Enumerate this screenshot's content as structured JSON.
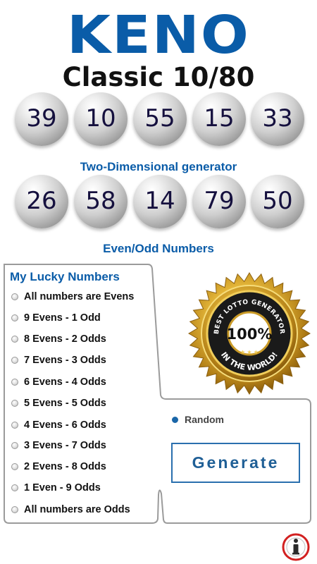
{
  "header": {
    "title": "KENO",
    "subtitle": "Classic 10/80"
  },
  "row1": [
    "39",
    "10",
    "55",
    "15",
    "33"
  ],
  "section_two_dimensional": "Two-Dimensional generator",
  "row2": [
    "26",
    "58",
    "14",
    "79",
    "50"
  ],
  "section_even_odd": "Even/Odd Numbers",
  "panel": {
    "heading": "My Lucky Numbers",
    "options": [
      "All numbers are Evens",
      "9 Evens - 1 Odd",
      "8 Evens - 2 Odds",
      "7 Evens - 3 Odds",
      "6 Evens - 4 Odds",
      "5 Evens - 5 Odds",
      "4 Evens - 6 Odds",
      "3 Evens - 7 Odds",
      "2 Evens - 8 Odds",
      "1 Even - 9 Odds",
      "All numbers are Odds"
    ],
    "random_label": "Random",
    "random_selected": true,
    "generate_label": "Generate"
  },
  "seal": {
    "arc_text": "BEST LOTTO GENERATOR",
    "center_text": "100%",
    "bottom_text": "IN THE WORLD!"
  },
  "colors": {
    "brand_blue": "#0a5ca8",
    "gold": "#d4a22a",
    "info_red": "#d22020"
  },
  "icons": {
    "info": "info-icon"
  }
}
